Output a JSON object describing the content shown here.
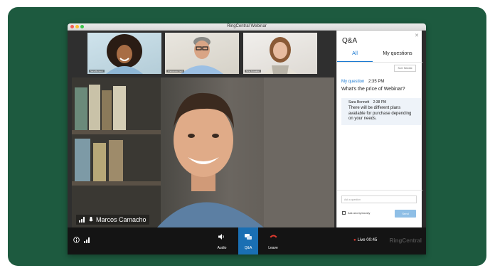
{
  "window": {
    "title": "RingCentral Webinar"
  },
  "thumbnails": [
    {
      "name": "Sara Bonnett"
    },
    {
      "name": "Francesco Cerri"
    },
    {
      "name": "Nina Kowalski"
    }
  ],
  "main": {
    "speaker": "Marcos Camacho"
  },
  "qa": {
    "title": "Q&A",
    "tabs": {
      "all": "All",
      "mine": "My questions"
    },
    "sort": "Sort: Newest",
    "question": {
      "label": "My question",
      "time": "2:35 PM",
      "text": "What's the price of Webinar?"
    },
    "answer": {
      "author": "Sara Bonnett",
      "time": "2:38 PM",
      "text": "There will be different plans available for purchase depending on your needs."
    },
    "input_placeholder": "Ask a question",
    "anonymous": "Ask anonymously",
    "send": "Send"
  },
  "toolbar": {
    "audio": "Audio",
    "qa": "Q&A",
    "leave": "Leave",
    "live": "Live 00:45",
    "brand": "RingCentral"
  },
  "colors": {
    "accent": "#1a79d1",
    "background": "#1d5a3f",
    "leave": "#e03a2f"
  }
}
